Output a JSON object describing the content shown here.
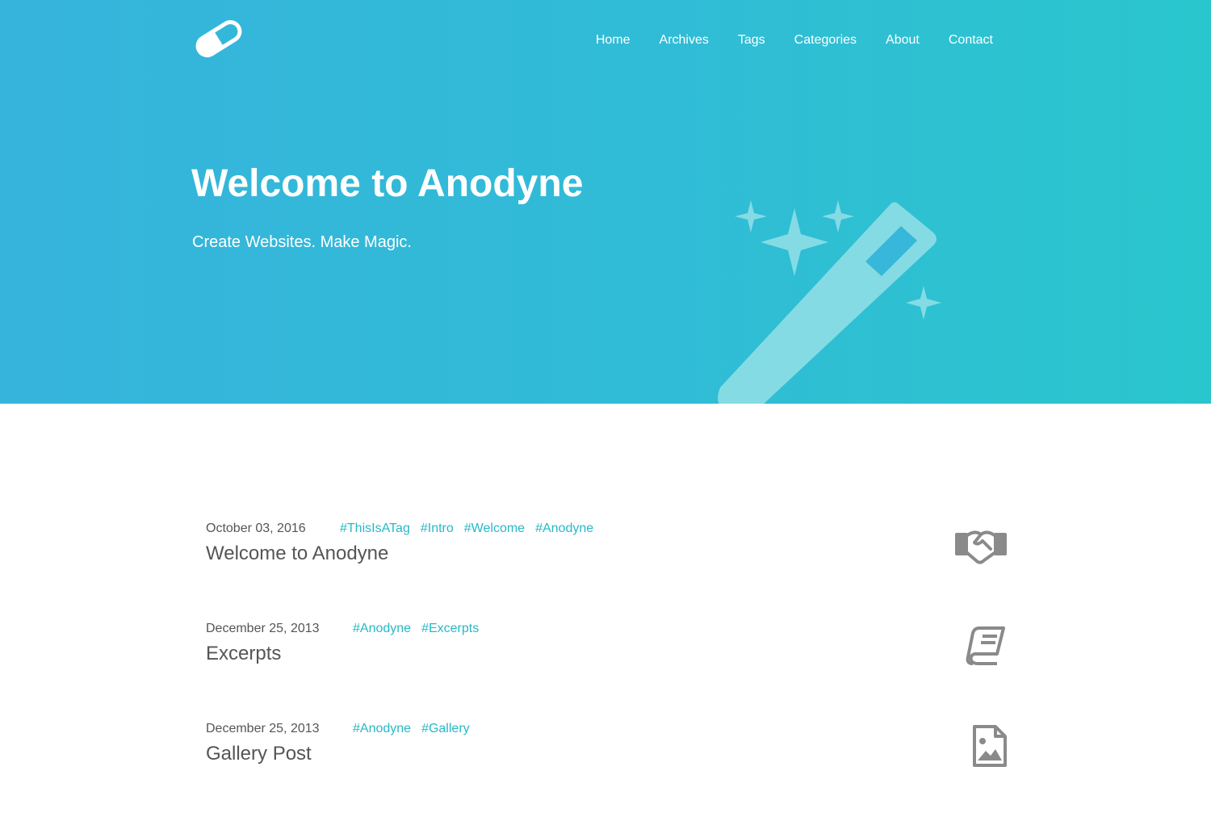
{
  "brand": {
    "logo_icon": "pill-icon",
    "gradient_start": "#36b4dc",
    "gradient_end": "#2ac6cd",
    "accent": "#26b9c6"
  },
  "nav": {
    "items": [
      {
        "label": "Home"
      },
      {
        "label": "Archives"
      },
      {
        "label": "Tags"
      },
      {
        "label": "Categories"
      },
      {
        "label": "About"
      },
      {
        "label": "Contact"
      }
    ]
  },
  "hero": {
    "title": "Welcome to Anodyne",
    "subtitle": "Create Websites. Make Magic.",
    "illustration": "magic-wand-icon"
  },
  "posts": [
    {
      "date": "October 03, 2016",
      "tags": [
        "#ThisIsATag",
        "#Intro",
        "#Welcome",
        "#Anodyne"
      ],
      "title": "Welcome to Anodyne",
      "icon": "handshake-icon"
    },
    {
      "date": "December 25, 2013",
      "tags": [
        "#Anodyne",
        "#Excerpts"
      ],
      "title": "Excerpts",
      "icon": "book-icon"
    },
    {
      "date": "December 25, 2013",
      "tags": [
        "#Anodyne",
        "#Gallery"
      ],
      "title": "Gallery Post",
      "icon": "image-file-icon"
    }
  ]
}
